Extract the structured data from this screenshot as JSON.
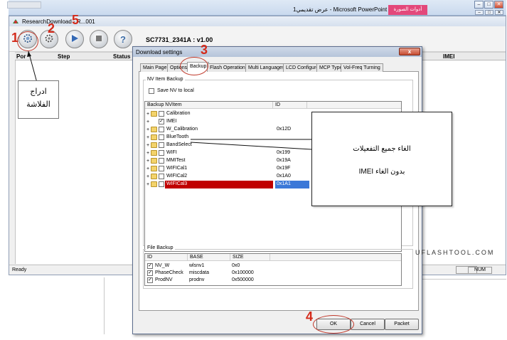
{
  "powerpoint": {
    "title": "عرض تقديمي1 - Microsoft PowerPoint",
    "context_tab": "أدوات الصورة",
    "controls": [
      "–",
      "□",
      "✕"
    ],
    "sub_controls": [
      "–",
      "□",
      "✕"
    ]
  },
  "app": {
    "title": "ResearchDownload - R...001",
    "firmware_label": "SC7731_2341A : v1.00",
    "columns": [
      "Por",
      "Step",
      "Status",
      "IMEI"
    ],
    "status": "Ready",
    "num_indicator": "NUM",
    "toolbar_icons": [
      "gear-icon",
      "settings-icon",
      "play-icon",
      "stop-icon",
      "help-icon"
    ]
  },
  "dialog": {
    "title": "Download settings",
    "close_label": "x",
    "tabs": [
      "Main Page",
      "Options",
      "Backup",
      "Flash Operations",
      "Multi Languages",
      "LCD Configure",
      "MCP Type",
      "Vol-Freq Turning"
    ],
    "active_tab": "Backup",
    "nv_group_label": "NV Item Backup",
    "save_nv_label": "Save NV to local",
    "nv_columns": [
      "Backup NVItem",
      "ID"
    ],
    "nv_items": [
      {
        "name": "Calibration",
        "id": "",
        "checked": false,
        "folder": true
      },
      {
        "name": "IMEI",
        "id": "",
        "checked": true,
        "folder": false
      },
      {
        "name": "W_Calibration",
        "id": "0x12D",
        "checked": false,
        "folder": true
      },
      {
        "name": "BlueTooth",
        "id": "",
        "checked": false,
        "folder": true
      },
      {
        "name": "BandSelect",
        "id": "",
        "checked": false,
        "folder": true
      },
      {
        "name": "WIFI",
        "id": "0x199",
        "checked": false,
        "folder": true
      },
      {
        "name": "MMITest",
        "id": "0x19A",
        "checked": false,
        "folder": true
      },
      {
        "name": "WIFICal1",
        "id": "0x19F",
        "checked": false,
        "folder": true
      },
      {
        "name": "WIFICal2",
        "id": "0x1A0",
        "checked": false,
        "folder": true
      },
      {
        "name": "WIFICal3",
        "id": "0x1A1",
        "checked": false,
        "folder": true,
        "selected": true
      }
    ],
    "file_group_label": "File Backup",
    "file_columns": [
      "ID",
      "BASE",
      "SIZE"
    ],
    "file_items": [
      {
        "id": "NV_W",
        "base": "wlsnv1",
        "size": "0x0",
        "checked": true
      },
      {
        "id": "PhaseCheck",
        "base": "miscdata",
        "size": "0x100000",
        "checked": true
      },
      {
        "id": "ProdNV",
        "base": "prodnv",
        "size": "0x500000",
        "checked": true
      }
    ],
    "buttons": {
      "ok": "OK",
      "cancel": "Cancel",
      "packet": "Packet"
    }
  },
  "annotations": {
    "step1_number": "1",
    "step2_number": "2",
    "step3_number": "3",
    "step4_number": "4",
    "step5_number": "5",
    "step1_text_line1": "ادراج",
    "step1_text_line2": "الفلاشة",
    "callout_line1": "الغاء جميع التفعيلات",
    "callout_line2": "بدون الغاء IMEI",
    "watermark": "UFLASHTOOL.COM",
    "accent_color": "#d42a1a",
    "selected_row_color": "#c00000",
    "selected_id_color": "#3b78d8"
  }
}
